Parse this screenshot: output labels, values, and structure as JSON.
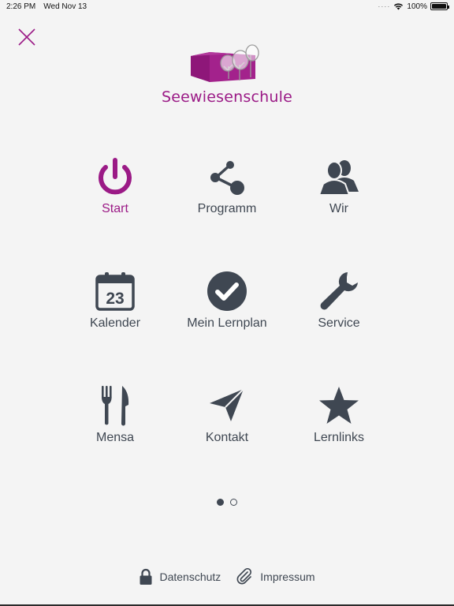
{
  "status_bar": {
    "time": "2:26 PM",
    "date": "Wed Nov 13",
    "battery": "100%",
    "battery_level": 1.0
  },
  "logo": {
    "name": "Seewiesenschule",
    "color": "#9b1a86"
  },
  "colors": {
    "accent": "#9b1a86",
    "icon": "#3f4752",
    "background": "#f4f4f4"
  },
  "menu": {
    "items": [
      {
        "label": "Start",
        "icon": "power-icon"
      },
      {
        "label": "Programm",
        "icon": "share-icon"
      },
      {
        "label": "Wir",
        "icon": "users-icon"
      },
      {
        "label": "Kalender",
        "icon": "calendar-icon",
        "calendar_day": "23"
      },
      {
        "label": "Mein Lernplan",
        "icon": "check-circle-icon"
      },
      {
        "label": "Service",
        "icon": "wrench-icon"
      },
      {
        "label": "Mensa",
        "icon": "fork-knife-icon"
      },
      {
        "label": "Kontakt",
        "icon": "paper-plane-icon"
      },
      {
        "label": "Lernlinks",
        "icon": "star-icon"
      }
    ],
    "active": "Start"
  },
  "pager": {
    "current_page": 1,
    "total_pages": 2
  },
  "footer": {
    "privacy_label": "Datenschutz",
    "imprint_label": "Impressum"
  }
}
